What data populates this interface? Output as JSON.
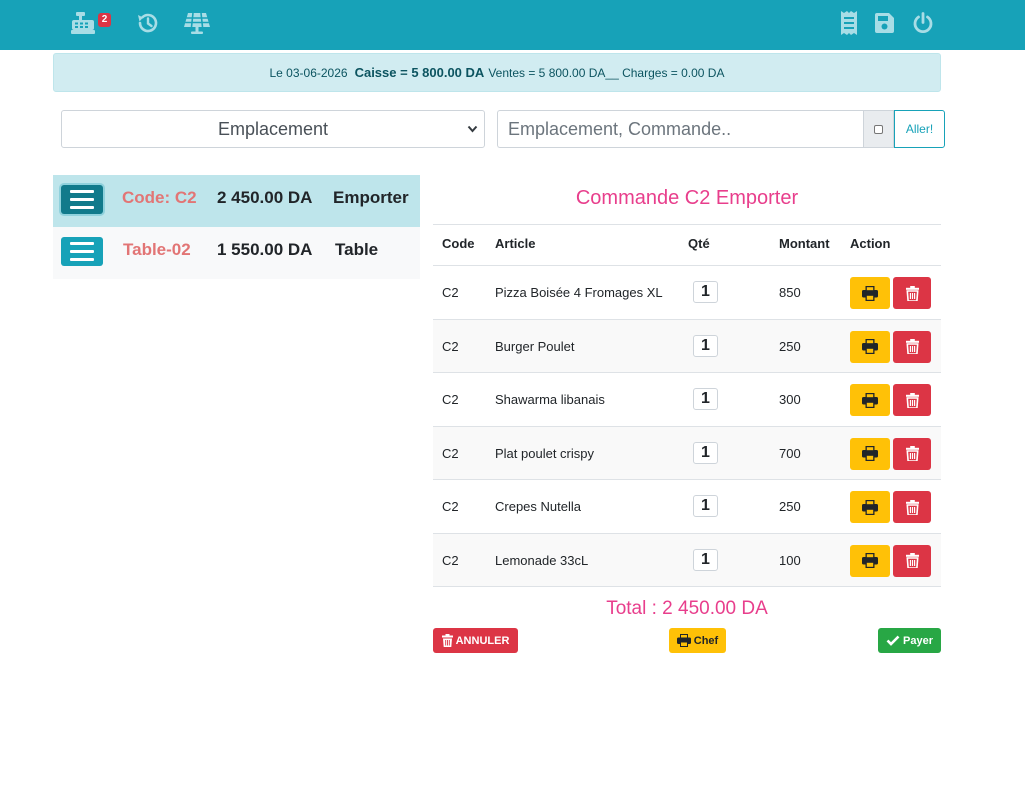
{
  "topbar": {
    "left_icons": [
      "cash-register-icon",
      "history-icon",
      "solar-panel-icon"
    ],
    "right_icons": [
      "receipt-icon",
      "save-icon",
      "power-icon"
    ],
    "register_badge": "2"
  },
  "summary": {
    "date_text": "Le 03-06-2026",
    "caisse_text": "Caisse = 5 800.00 DA",
    "ventes_charges_text": "Ventes = 5 800.00 DA__ Charges = 0.00 DA"
  },
  "filters": {
    "location_select": "Emplacement",
    "search_placeholder": "Emplacement, Commande..",
    "go_label": "Aller!"
  },
  "orders": [
    {
      "code": "Code: C2",
      "amount": "2 450.00 DA",
      "type": "Emporter"
    },
    {
      "code": "Table-02",
      "amount": "1 550.00 DA",
      "type": "Table"
    }
  ],
  "command": {
    "title": "Commande C2 Emporter",
    "headers": {
      "code": "Code",
      "article": "Article",
      "qty": "Qté",
      "amount": "Montant",
      "action": "Action"
    },
    "items": [
      {
        "code": "C2",
        "article": "Pizza Boisée 4 Fromages XL",
        "qty": "1",
        "amount": "850"
      },
      {
        "code": "C2",
        "article": "Burger Poulet",
        "qty": "1",
        "amount": "250"
      },
      {
        "code": "C2",
        "article": "Shawarma libanais",
        "qty": "1",
        "amount": "300"
      },
      {
        "code": "C2",
        "article": "Plat poulet crispy",
        "qty": "1",
        "amount": "700"
      },
      {
        "code": "C2",
        "article": "Crepes Nutella",
        "qty": "1",
        "amount": "250"
      },
      {
        "code": "C2",
        "article": "Lemonade 33cL",
        "qty": "1",
        "amount": "100"
      }
    ],
    "total": "Total : 2 450.00 DA",
    "cancel_label": "ANNULER",
    "chef_label": "Chef",
    "pay_label": "Payer"
  },
  "colors": {
    "topbar": "#17a2b8",
    "accent_pink": "#e83e8c",
    "order_code": "#e27575",
    "warning": "#ffc107",
    "danger": "#dc3545",
    "success": "#28a745"
  }
}
